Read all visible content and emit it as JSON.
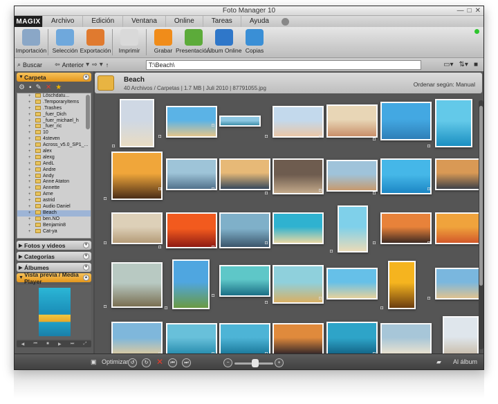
{
  "window": {
    "title": "Foto Manager 10"
  },
  "menu": {
    "logo": "MAGIX",
    "items": [
      "Archivo",
      "Edición",
      "Ventana",
      "Online",
      "Tareas",
      "Ayuda"
    ]
  },
  "toolbar": {
    "buttons": [
      {
        "label": "Importación",
        "icon": "import-icon",
        "color": "#8aa7c7"
      },
      {
        "label": "Selección",
        "icon": "selection-icon",
        "color": "#6fa8dc"
      },
      {
        "label": "Exportación",
        "icon": "export-icon",
        "color": "#e07a2f"
      },
      {
        "label": "Imprimir",
        "icon": "printer-icon",
        "color": "#d9d9d9"
      },
      {
        "label": "Grabar",
        "icon": "burn-disc-icon",
        "color": "#f08c1a"
      },
      {
        "label": "Presentació...",
        "icon": "slideshow-icon",
        "color": "#5cab3a"
      },
      {
        "label": "Álbum Online",
        "icon": "online-album-icon",
        "color": "#2f77c9"
      },
      {
        "label": "Copias",
        "icon": "copies-icon",
        "color": "#3a8fd6"
      }
    ]
  },
  "addressbar": {
    "search": "Buscar",
    "back": "Anterior",
    "path": "T:\\Beach\\"
  },
  "sidebar": {
    "folder_panel": "Carpeta",
    "tree": [
      "Löschdatu...",
      ".TemporaryItems",
      ".Trashes",
      "_fuer_Dich",
      "_fuer_michael_h",
      "_fuer_ric",
      "10",
      "4steven",
      "Across_v5.0_SP1_...",
      "alex",
      "alexg",
      "AndL",
      "Andre",
      "Andy",
      "Anne Ataton",
      "Annette",
      "Arne",
      "astrid",
      "Audio Daniel",
      "Beach",
      "ben.NO",
      "Benjamin8",
      "Cat-ya"
    ],
    "selected": "Beach",
    "panels": [
      "Fotos y videos",
      "Categorías",
      "Álbumes"
    ],
    "preview_panel": "Vista previa / Media Player"
  },
  "content": {
    "folder_name": "Beach",
    "folder_info": "40 Archivos / Carpetas | 1.7 MB | Juli 2010 | 87791055.jpg",
    "sort_label": "Ordenar según: Manual"
  },
  "bottombar": {
    "optimize": "Optimizar",
    "album": "Al álbum"
  },
  "thumbs": [
    {
      "name": "beach-woman-white",
      "colors": [
        "#cfd8e4",
        "#e9dcc3"
      ]
    },
    {
      "name": "beach-chairs",
      "colors": [
        "#5bb3e6",
        "#e3c58b"
      ]
    },
    {
      "name": "beach-panorama",
      "colors": [
        "#8dc7e2",
        "#3f8fa9"
      ]
    },
    {
      "name": "seashell",
      "colors": [
        "#c3d9ec",
        "#e9c6a6"
      ]
    },
    {
      "name": "woman-bikini-sand",
      "colors": [
        "#e8d6b6",
        "#c98f6a"
      ]
    },
    {
      "name": "palm-island",
      "colors": [
        "#43a8e2",
        "#2e7fb8"
      ]
    },
    {
      "name": "woman-water",
      "colors": [
        "#63c9e9",
        "#1a8fc1"
      ]
    },
    {
      "name": "palm-sunset",
      "colors": [
        "#f0a63a",
        "#4a2d18"
      ]
    },
    {
      "name": "beach-people",
      "colors": [
        "#9ec4d8",
        "#52728c"
      ]
    },
    {
      "name": "palms-dusk",
      "colors": [
        "#e7b977",
        "#36495c"
      ]
    },
    {
      "name": "sailing-deck",
      "colors": [
        "#6e5c4f",
        "#c3a98a"
      ]
    },
    {
      "name": "cliff-coast",
      "colors": [
        "#9fc3da",
        "#c79a6e"
      ]
    },
    {
      "name": "pool-water",
      "colors": [
        "#45b7e8",
        "#1c86c4"
      ]
    },
    {
      "name": "sunset-pier",
      "colors": [
        "#d99955",
        "#3e4148"
      ]
    },
    {
      "name": "shell-sand",
      "colors": [
        "#ddd0b8",
        "#b59c78"
      ]
    },
    {
      "name": "red-sunset",
      "colors": [
        "#f25a1e",
        "#8e1b14"
      ]
    },
    {
      "name": "gondola",
      "colors": [
        "#7fb0c9",
        "#3b556b"
      ]
    },
    {
      "name": "palm-lagoon",
      "colors": [
        "#2fb2d0",
        "#e8d8a4"
      ]
    },
    {
      "name": "starfish",
      "colors": [
        "#7fd0ea",
        "#eadbb8"
      ]
    },
    {
      "name": "hammock",
      "colors": [
        "#e8823a",
        "#3e2a22"
      ]
    },
    {
      "name": "cocktails",
      "colors": [
        "#f0a33c",
        "#d2582a"
      ]
    },
    {
      "name": "lake-woman",
      "colors": [
        "#b8c9c2",
        "#7a6f52"
      ]
    },
    {
      "name": "palm-tall",
      "colors": [
        "#4fa6e0",
        "#6a9a44"
      ]
    },
    {
      "name": "wave-surf",
      "colors": [
        "#5ec7c8",
        "#1b6e85"
      ]
    },
    {
      "name": "beach-tent",
      "colors": [
        "#8fd0dc",
        "#d9b064"
      ]
    },
    {
      "name": "jumping-people",
      "colors": [
        "#66c0e8",
        "#e5d19c"
      ]
    },
    {
      "name": "golden-sunset",
      "colors": [
        "#f5b41f",
        "#6b3d10"
      ]
    },
    {
      "name": "woman-lying-sand",
      "colors": [
        "#7ab7de",
        "#dfc290"
      ]
    },
    {
      "name": "beach-hut",
      "colors": [
        "#7fb7db",
        "#e6cc9a"
      ]
    },
    {
      "name": "woman-surf",
      "colors": [
        "#68c0da",
        "#2a8fb0"
      ]
    },
    {
      "name": "man-water",
      "colors": [
        "#4db4d6",
        "#1d7b9d"
      ]
    },
    {
      "name": "pool-sunset",
      "colors": [
        "#e08a3c",
        "#3b2b2a"
      ]
    },
    {
      "name": "jetski",
      "colors": [
        "#2ea4c8",
        "#0f5c7e"
      ]
    },
    {
      "name": "beach-loungers",
      "colors": [
        "#a7c6d8",
        "#e8e1d0"
      ]
    },
    {
      "name": "woman-standing",
      "colors": [
        "#dfe6ec",
        "#c2b096"
      ]
    }
  ]
}
